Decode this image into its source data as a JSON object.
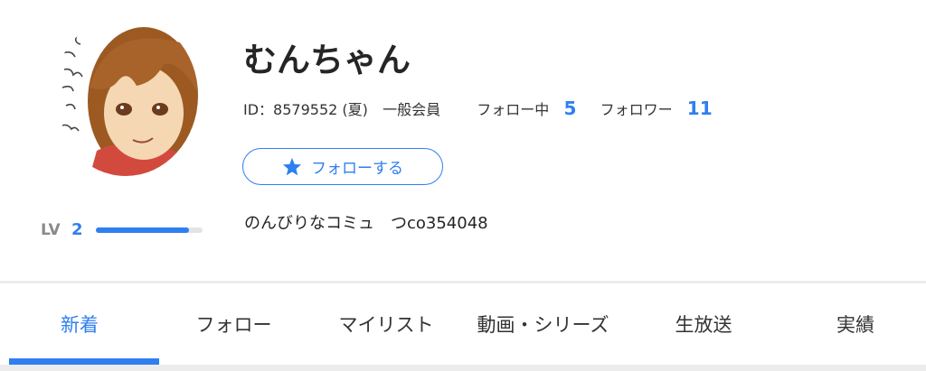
{
  "profile": {
    "name": "むんちゃん",
    "id_label": "ID：8579552 (夏)",
    "member_type": "一般会員",
    "following_label": "フォロー中",
    "following_count": "5",
    "followers_label": "フォロワー",
    "followers_count": "11",
    "follow_button_label": "フォローする",
    "description": "のんびりなコミュ　つco354048",
    "level_label": "LV",
    "level_value": "2",
    "level_progress": 0.87
  },
  "tabs": [
    {
      "label": "新着",
      "active": true
    },
    {
      "label": "フォロー",
      "active": false
    },
    {
      "label": "マイリスト",
      "active": false
    },
    {
      "label": "動画・シリーズ",
      "active": false
    },
    {
      "label": "生放送",
      "active": false
    },
    {
      "label": "実績",
      "active": false
    }
  ],
  "colors": {
    "accent": "#2f7ff0",
    "text": "#252525",
    "muted": "#8a8a8a",
    "track": "#e4e4e4",
    "divider": "#ececec"
  },
  "icons": {
    "follow_button": "star-icon",
    "avatar": "user-avatar"
  }
}
